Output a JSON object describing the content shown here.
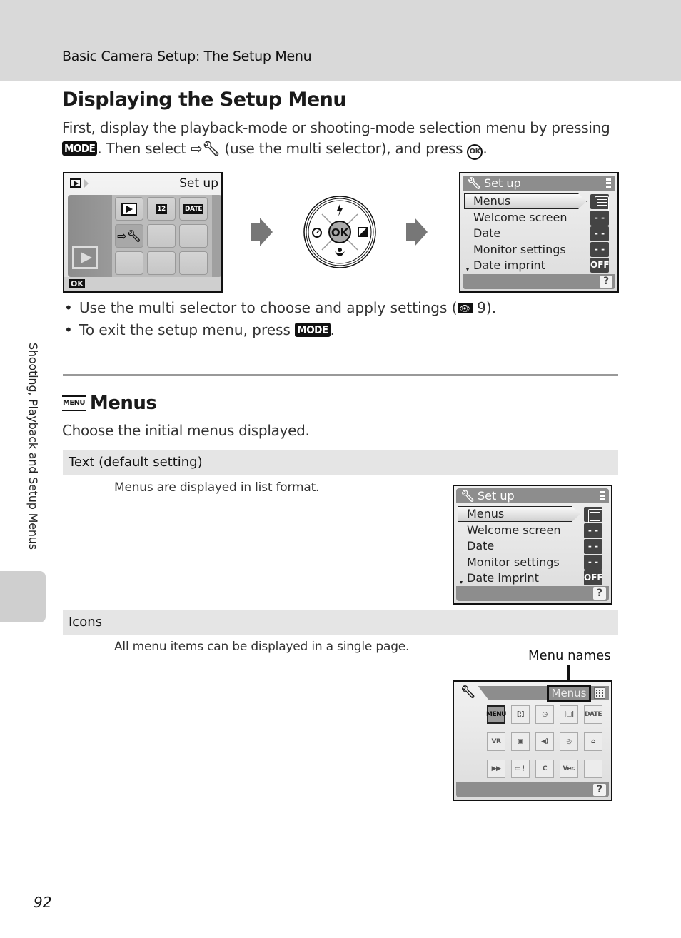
{
  "header": {
    "running_head": "Basic Camera Setup: The Setup Menu"
  },
  "section1": {
    "title": "Displaying the Setup Menu",
    "intro_line1": "First, display the playback-mode or shooting-mode selection menu by pressing",
    "intro_line2_a": ". Then select",
    "intro_line2_b": "(use the multi selector), and press",
    "intro_line2_c": ".",
    "mode_button": "MODE",
    "ok_button": "OK",
    "setup_icon": "setup-wrench-icon",
    "bullets": [
      {
        "text_a": "Use the multi selector to choose and apply settings (",
        "ref_icon": "reference-icon",
        "ref_page": "9",
        "text_b": ")."
      },
      {
        "text_a": "To exit the setup menu, press",
        "mode_button": "MODE",
        "text_b": "."
      }
    ]
  },
  "playback_screen": {
    "title": "Set up",
    "mode_icon": "playback-icon",
    "ok_label": "OK",
    "grid": [
      {
        "icon": "playback-icon",
        "label": ""
      },
      {
        "icon": "calendar-icon",
        "label": "12"
      },
      {
        "icon": "date-icon",
        "label": "DATE"
      },
      {
        "icon": "setup-wrench-icon",
        "label": "",
        "selected": true
      },
      {
        "icon": "",
        "label": ""
      },
      {
        "icon": "",
        "label": ""
      },
      {
        "icon": "",
        "label": ""
      },
      {
        "icon": "",
        "label": ""
      },
      {
        "icon": "",
        "label": ""
      }
    ]
  },
  "multi_selector": {
    "center": "OK",
    "up": "flash-icon",
    "left": "self-timer-icon",
    "right": "exposure-compensation-icon",
    "down": "macro-icon"
  },
  "setup_list_screen": {
    "title": "Set up",
    "items": [
      {
        "label": "Menus",
        "value": "",
        "value_icon": "list-icon",
        "selected": true
      },
      {
        "label": "Welcome screen",
        "value": "- -"
      },
      {
        "label": "Date",
        "value": "- -"
      },
      {
        "label": "Monitor settings",
        "value": "- -"
      },
      {
        "label": "Date imprint",
        "value": "OFF",
        "more_below": true
      }
    ],
    "help": "?"
  },
  "section2": {
    "title": "Menus",
    "title_icon": "MENU",
    "description": "Choose the initial menus displayed.",
    "options": [
      {
        "name": "Text (default setting)",
        "description": "Menus are displayed in list format."
      },
      {
        "name": "Icons",
        "description": "All menu items can be displayed in a single page."
      }
    ]
  },
  "setup_list_screen_2": {
    "title": "Set up",
    "items": [
      {
        "label": "Menus",
        "value": "",
        "value_icon": "list-icon",
        "selected": true
      },
      {
        "label": "Welcome screen",
        "value": "- -"
      },
      {
        "label": "Date",
        "value": "- -"
      },
      {
        "label": "Monitor settings",
        "value": "- -"
      },
      {
        "label": "Date imprint",
        "value": "OFF",
        "more_below": true
      }
    ],
    "help": "?"
  },
  "icon_screen": {
    "callout": "Menu names",
    "menu_name": "Menus",
    "tiles": [
      {
        "icon": "menus-icon",
        "label": "MENU",
        "selected": true
      },
      {
        "icon": "welcome-screen-icon",
        "label": "[¦]"
      },
      {
        "icon": "date-clock-icon",
        "label": "◷"
      },
      {
        "icon": "monitor-settings-icon",
        "label": "|▢|"
      },
      {
        "icon": "date-imprint-icon",
        "label": "DATE"
      },
      {
        "icon": "vibration-reduction-icon",
        "label": "VR"
      },
      {
        "icon": "motion-detection-icon",
        "label": "▣"
      },
      {
        "icon": "sound-settings-icon",
        "label": "◀)"
      },
      {
        "icon": "auto-off-icon",
        "label": "◴"
      },
      {
        "icon": "format-memory-icon",
        "label": "⌂"
      },
      {
        "icon": "language-icon",
        "label": "▶▶"
      },
      {
        "icon": "interface-icon",
        "label": "▭⋮"
      },
      {
        "icon": "reset-all-icon",
        "label": "C"
      },
      {
        "icon": "firmware-version-icon",
        "label": "Ver."
      },
      {
        "icon": "",
        "label": ""
      }
    ],
    "help": "?"
  },
  "side_tab": {
    "text": "Shooting, Playback and Setup Menus"
  },
  "footer": {
    "page_number": "92"
  }
}
